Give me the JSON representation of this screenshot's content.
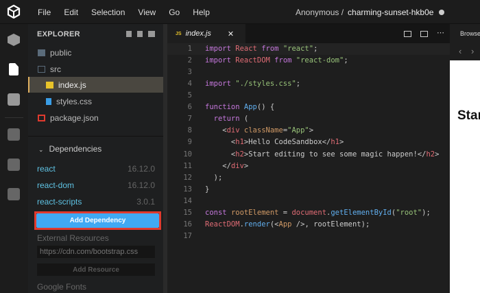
{
  "menu": [
    "File",
    "Edit",
    "Selection",
    "View",
    "Go",
    "Help"
  ],
  "header": {
    "owner": "Anonymous /",
    "sandbox": "charming-sunset-hkb0e"
  },
  "explorer": {
    "title": "EXPLORER",
    "files": [
      {
        "name": "public",
        "type": "folder"
      },
      {
        "name": "src",
        "type": "folder"
      },
      {
        "name": "index.js",
        "type": "js",
        "selected": true
      },
      {
        "name": "styles.css",
        "type": "css"
      },
      {
        "name": "package.json",
        "type": "json"
      }
    ]
  },
  "dependencies": {
    "title": "Dependencies",
    "items": [
      {
        "name": "react",
        "version": "16.12.0"
      },
      {
        "name": "react-dom",
        "version": "16.12.0"
      },
      {
        "name": "react-scripts",
        "version": "3.0.1"
      }
    ],
    "add_label": "Add Dependency"
  },
  "external": {
    "title": "External Resources",
    "input_placeholder": "https://cdn.com/bootstrap.css",
    "add_label": "Add Resource"
  },
  "fonts": {
    "title": "Google Fonts"
  },
  "editor": {
    "tab_icon": "JS",
    "tab": "index.js",
    "lines": [
      [
        [
          "import ",
          "kw"
        ],
        [
          "React ",
          "id"
        ],
        [
          "from ",
          "kw"
        ],
        [
          "\"react\"",
          "st"
        ],
        [
          ";",
          "pl"
        ]
      ],
      [
        [
          "import ",
          "kw"
        ],
        [
          "ReactDOM ",
          "id"
        ],
        [
          "from ",
          "kw"
        ],
        [
          "\"react-dom\"",
          "st"
        ],
        [
          ";",
          "pl"
        ]
      ],
      [],
      [
        [
          "import ",
          "kw"
        ],
        [
          "\"./styles.css\"",
          "st"
        ],
        [
          ";",
          "pl"
        ]
      ],
      [],
      [
        [
          "function ",
          "kw"
        ],
        [
          "App",
          "fn"
        ],
        [
          "() {",
          "pl"
        ]
      ],
      [
        [
          "  return ",
          "kw"
        ],
        [
          "(",
          "pl"
        ]
      ],
      [
        [
          "    <",
          "pl"
        ],
        [
          "div ",
          "tg"
        ],
        [
          "className",
          "at"
        ],
        [
          "=",
          "pl"
        ],
        [
          "\"App\"",
          "st"
        ],
        [
          ">",
          "pl"
        ]
      ],
      [
        [
          "      <",
          "pl"
        ],
        [
          "h1",
          "tg"
        ],
        [
          ">Hello CodeSandbox</",
          "pl"
        ],
        [
          "h1",
          "tg"
        ],
        [
          ">",
          "pl"
        ]
      ],
      [
        [
          "      <",
          "pl"
        ],
        [
          "h2",
          "tg"
        ],
        [
          ">Start editing to see some magic happen!</",
          "pl"
        ],
        [
          "h2",
          "tg"
        ],
        [
          ">",
          "pl"
        ]
      ],
      [
        [
          "    </",
          "pl"
        ],
        [
          "div",
          "tg"
        ],
        [
          ">",
          "pl"
        ]
      ],
      [
        [
          "  );",
          "pl"
        ]
      ],
      [
        [
          "}",
          "pl"
        ]
      ],
      [],
      [
        [
          "const ",
          "kw"
        ],
        [
          "rootElement ",
          "at"
        ],
        [
          "= ",
          "pl"
        ],
        [
          "document",
          "id"
        ],
        [
          ".",
          "pl"
        ],
        [
          "getElementById",
          "fn"
        ],
        [
          "(",
          "pl"
        ],
        [
          "\"root\"",
          "st"
        ],
        [
          ");",
          "pl"
        ]
      ],
      [
        [
          "ReactDOM",
          "id"
        ],
        [
          ".",
          "pl"
        ],
        [
          "render",
          "fn"
        ],
        [
          "(<",
          "pl"
        ],
        [
          "App ",
          "at"
        ],
        [
          "/>, rootElement);",
          "pl"
        ]
      ],
      []
    ]
  },
  "preview": {
    "tab": "Browser",
    "heading": "Start"
  }
}
